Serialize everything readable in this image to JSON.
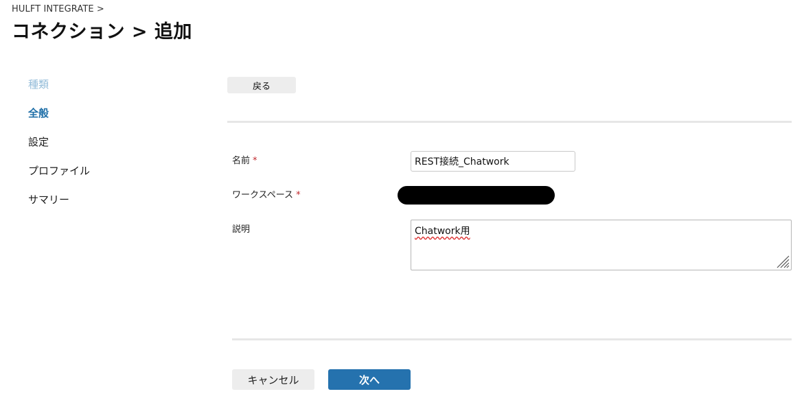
{
  "header": {
    "breadcrumb": "HULFT INTEGRATE >",
    "title": "コネクション > 追加"
  },
  "steps": [
    {
      "label": "種類",
      "state": "done"
    },
    {
      "label": "全般",
      "state": "current"
    },
    {
      "label": "設定",
      "state": "pending"
    },
    {
      "label": "プロファイル",
      "state": "pending"
    },
    {
      "label": "サマリー",
      "state": "pending"
    }
  ],
  "toolbar": {
    "back_label": "戻る"
  },
  "form": {
    "name": {
      "label": "名前",
      "required_mark": "*",
      "value": "REST接続_Chatwork"
    },
    "workspace": {
      "label": "ワークスペース",
      "required_mark": "*",
      "redacted": true
    },
    "description": {
      "label": "説明",
      "value": "Chatwork用"
    }
  },
  "footer": {
    "cancel_label": "キャンセル",
    "next_label": "次へ"
  },
  "colors": {
    "primary": "#2572ae",
    "step_current": "#1f6fa8",
    "step_done": "#93bcd9",
    "required": "#c0282d",
    "button_secondary": "#ededed"
  }
}
